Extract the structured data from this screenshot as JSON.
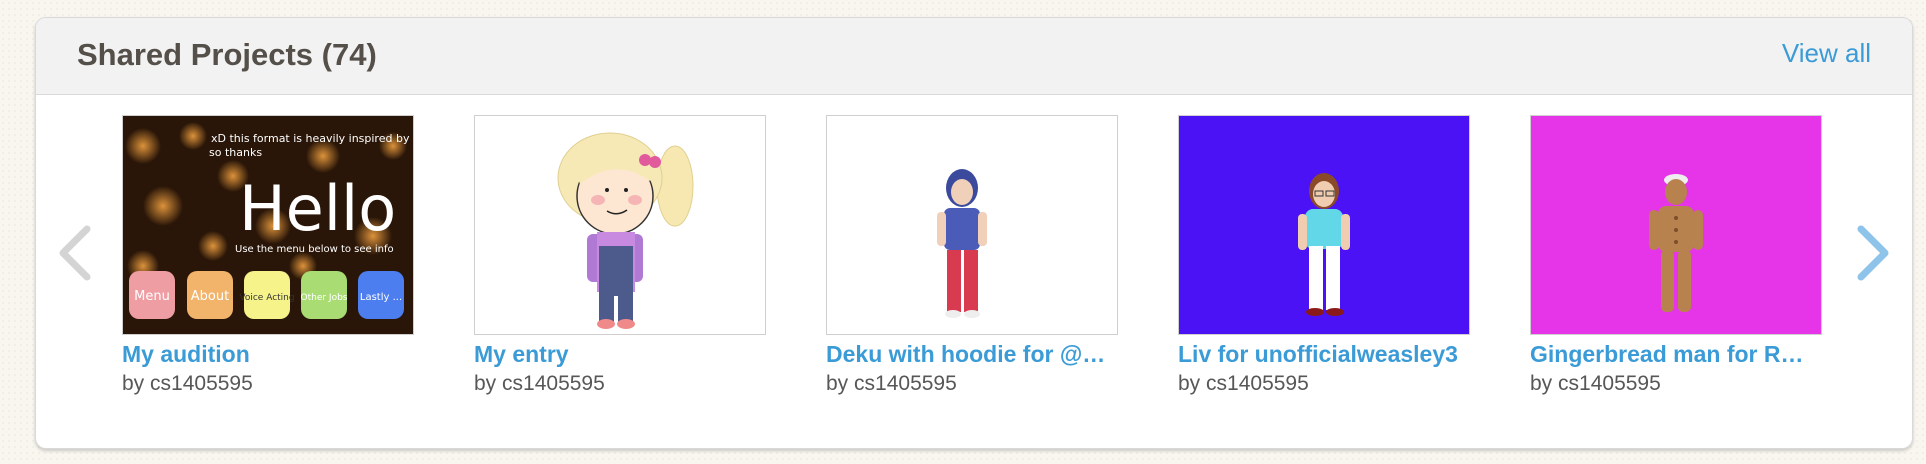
{
  "header": {
    "title": "Shared Projects (74)",
    "view_all": "View all"
  },
  "icons": {
    "prev": "chevron-left-icon",
    "next": "chevron-right-icon"
  },
  "colors": {
    "link": "#3a9bd7",
    "title_text": "#554f4a",
    "thumb_blue": "#4a12f5",
    "thumb_magenta": "#e634e8"
  },
  "projects": [
    {
      "title": "My audition",
      "by_prefix": "by",
      "author": "cs1405595",
      "thumb": {
        "line1": "xD this format is heavily inspired by",
        "line2": "so thanks",
        "hello": "Hello",
        "instruction": "Use the menu below to see info",
        "buttons": [
          "Menu",
          "About",
          "Voice Acting",
          "Other Jobs",
          "Lastly ..."
        ]
      }
    },
    {
      "title": "My entry",
      "by_prefix": "by",
      "author": "cs1405595"
    },
    {
      "title": "Deku with hoodie for @…",
      "by_prefix": "by",
      "author": "cs1405595"
    },
    {
      "title": "Liv for unofficialweasley3",
      "by_prefix": "by",
      "author": "cs1405595"
    },
    {
      "title": "Gingerbread man for R…",
      "by_prefix": "by",
      "author": "cs1405595"
    }
  ]
}
